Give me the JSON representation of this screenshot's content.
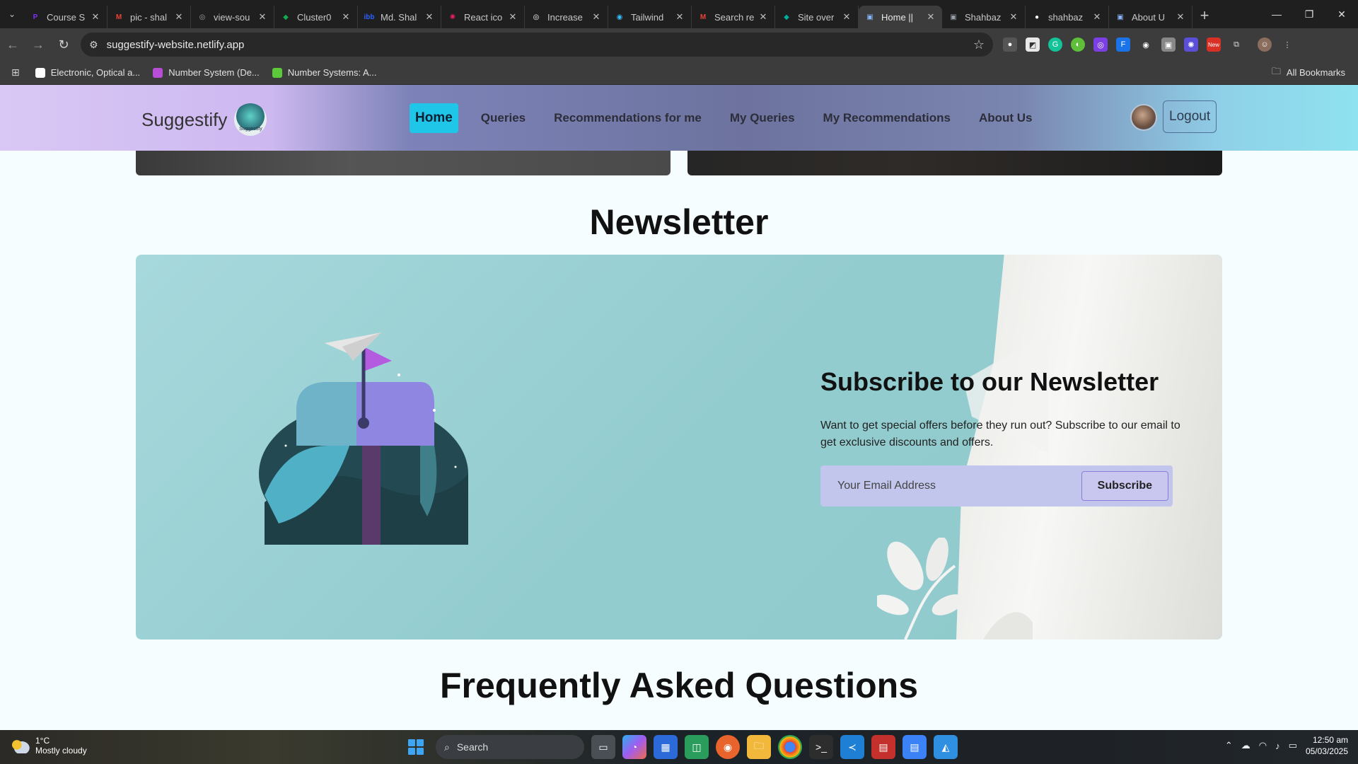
{
  "browser": {
    "tabs": [
      {
        "title": "Course S",
        "fav_color": "#7b2ff7",
        "fav_glyph": "P"
      },
      {
        "title": "pic - shal",
        "fav_color": "#ea4335",
        "fav_glyph": "M"
      },
      {
        "title": "view-sou",
        "fav_color": "#9aa0a6",
        "fav_glyph": "◎"
      },
      {
        "title": "Cluster0",
        "fav_color": "#13aa52",
        "fav_glyph": "◆"
      },
      {
        "title": "Md. Shal",
        "fav_color": "#2962ff",
        "fav_glyph": "ibb"
      },
      {
        "title": "React ico",
        "fav_color": "#e91e63",
        "fav_glyph": "✺"
      },
      {
        "title": "Increase",
        "fav_color": "#ffffff",
        "fav_glyph": "◎"
      },
      {
        "title": "Tailwind",
        "fav_color": "#38bdf8",
        "fav_glyph": "◉"
      },
      {
        "title": "Search re",
        "fav_color": "#ea4335",
        "fav_glyph": "M"
      },
      {
        "title": "Site over",
        "fav_color": "#00ad9f",
        "fav_glyph": "◆"
      },
      {
        "title": "Home ||",
        "fav_color": "#8ab4f8",
        "fav_glyph": "▣",
        "active": true
      },
      {
        "title": "Shahbaz",
        "fav_color": "#9aa0a6",
        "fav_glyph": "▣"
      },
      {
        "title": "shahbaz",
        "fav_color": "#ffffff",
        "fav_glyph": "●"
      },
      {
        "title": "About U",
        "fav_color": "#8ab4f8",
        "fav_glyph": "▣"
      }
    ],
    "url": "suggestify-website.netlify.app",
    "bookmarks": [
      {
        "label": "Electronic, Optical a...",
        "color": "#ffffff"
      },
      {
        "label": "Number System (De...",
        "color": "#b84dd6"
      },
      {
        "label": "Number Systems: A...",
        "color": "#5cc93b"
      }
    ],
    "all_bookmarks": "All Bookmarks"
  },
  "site": {
    "brand": "Suggestify",
    "logo_text": "Suggestify",
    "nav": [
      {
        "label": "Home",
        "active": true
      },
      {
        "label": "Queries"
      },
      {
        "label": "Recommendations for me"
      },
      {
        "label": "My Queries"
      },
      {
        "label": "My Recommendations"
      },
      {
        "label": "About Us"
      }
    ],
    "logout": "Logout"
  },
  "newsletter": {
    "section_title": "Newsletter",
    "heading": "Subscribe to our Newsletter",
    "text": "Want to get special offers before they run out? Subscribe to our email to get exclusive discounts and offers.",
    "email_placeholder": "Your Email Address",
    "button": "Subscribe"
  },
  "faq": {
    "section_title": "Frequently Asked Questions"
  },
  "taskbar": {
    "temp": "1°C",
    "weather": "Mostly cloudy",
    "search": "Search",
    "time": "12:50 am",
    "date": "05/03/2025"
  }
}
